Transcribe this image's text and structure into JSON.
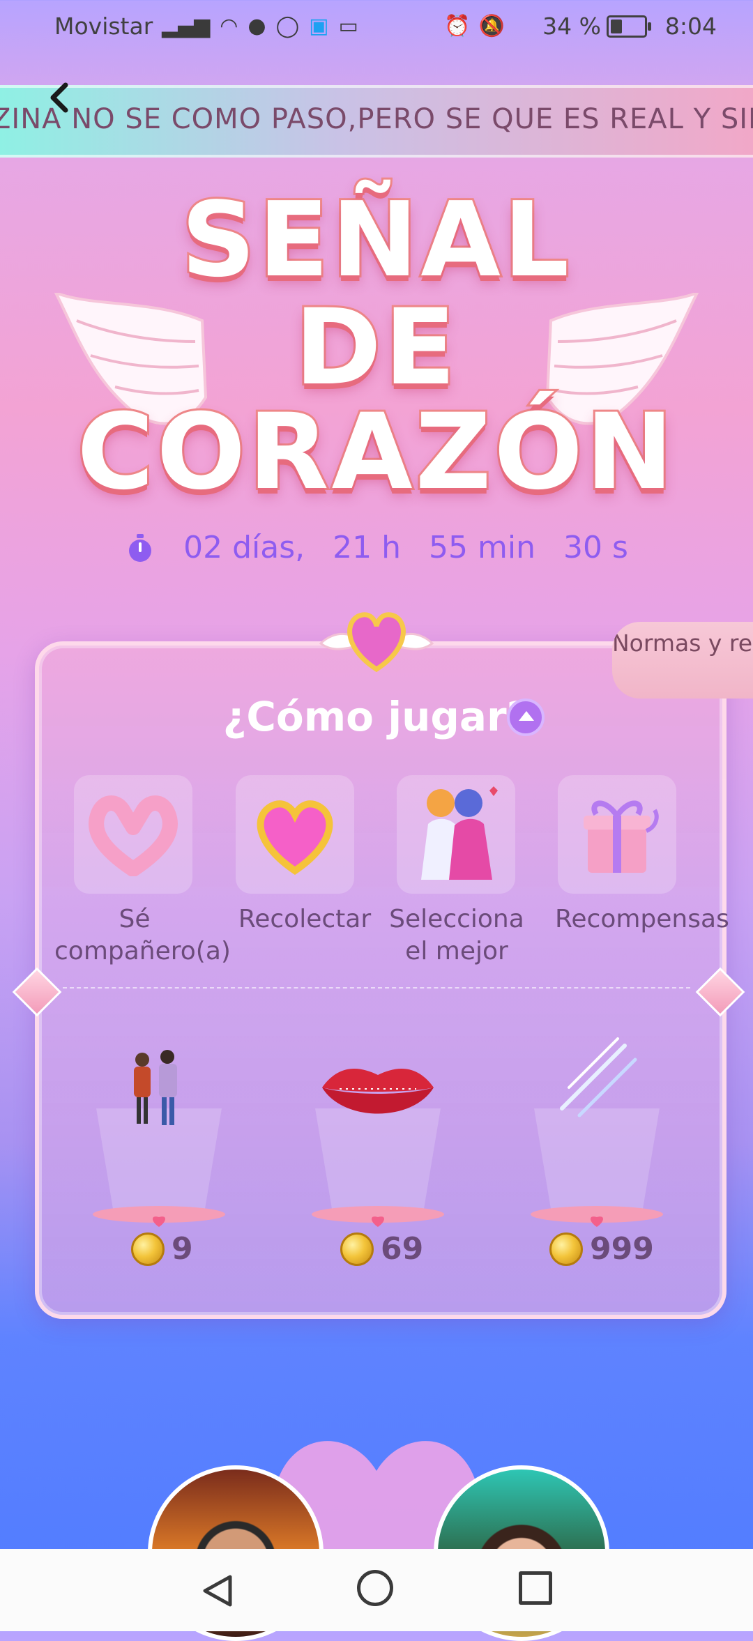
{
  "status_bar": {
    "carrier": "Movistar",
    "battery": "34 %",
    "battery_level": 0.34,
    "time": "8:04"
  },
  "marquee": {
    "text": "ZINA NO SE COMO PASO,PERO SE QUE ES REAL Y SIEMPRE"
  },
  "event": {
    "title_line1": "SEÑAL",
    "title_line2": "DE CORAZÓN"
  },
  "countdown": {
    "days": "02 días,",
    "hours": "21 h",
    "minutes": "55 min",
    "seconds": "30 s"
  },
  "rules_button": "Normas y recompensas",
  "how_to_play": {
    "title": "¿Cómo jugar?",
    "steps": [
      {
        "label": "Sé compañero(a)",
        "icon": "heart-hands-icon"
      },
      {
        "label": "Recolectar",
        "icon": "gold-heart-icon"
      },
      {
        "label": "Selecciona el mejor",
        "icon": "hugging-couple-icon"
      },
      {
        "label": "Recompensas",
        "icon": "gift-box-icon"
      }
    ]
  },
  "prizes": [
    {
      "icon": "couple-walking-icon",
      "price": "9"
    },
    {
      "icon": "red-lips-icon",
      "price": "69"
    },
    {
      "icon": "shooting-stars-icon",
      "price": "999"
    }
  ],
  "colors": {
    "accent": "#8e5cf0",
    "title_stroke": "#f08a8a",
    "card_border": "#ffdceb"
  }
}
